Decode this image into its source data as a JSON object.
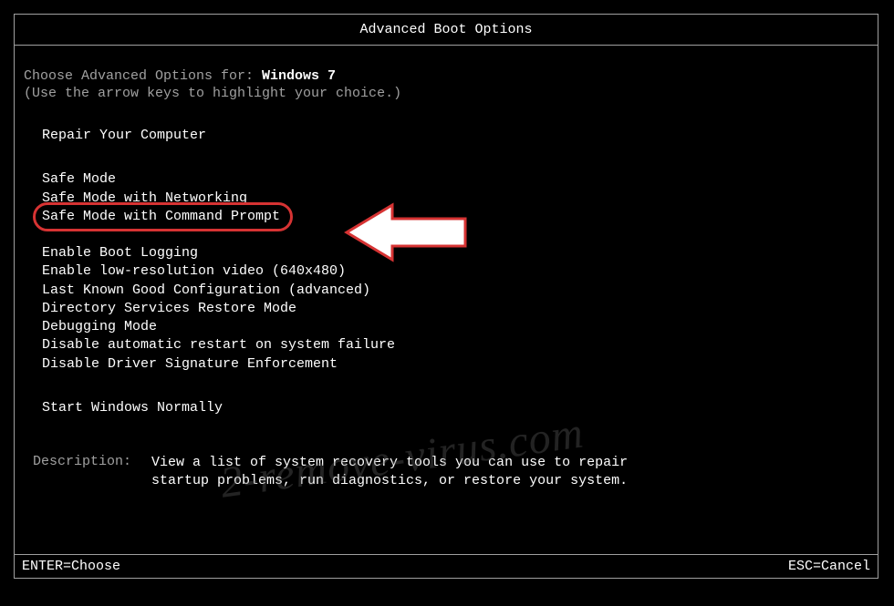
{
  "title": "Advanced Boot Options",
  "choose_prefix": "Choose Advanced Options for: ",
  "os_name": "Windows 7",
  "hint": "(Use the arrow keys to highlight your choice.)",
  "repair_option": "Repair Your Computer",
  "safe_modes": {
    "safe_mode": "Safe Mode",
    "safe_mode_net": "Safe Mode with Networking",
    "safe_mode_cmd": "Safe Mode with Command Prompt"
  },
  "other_options": {
    "boot_logging": "Enable Boot Logging",
    "low_res": "Enable low-resolution video (640x480)",
    "last_known": "Last Known Good Configuration (advanced)",
    "ds_restore": "Directory Services Restore Mode",
    "debugging": "Debugging Mode",
    "disable_restart": "Disable automatic restart on system failure",
    "disable_driver_sig": "Disable Driver Signature Enforcement"
  },
  "start_normal": "Start Windows Normally",
  "description": {
    "label": "Description:",
    "text": "View a list of system recovery tools you can use to repair startup problems, run diagnostics, or restore your system."
  },
  "footer": {
    "enter": "ENTER=Choose",
    "esc": "ESC=Cancel"
  },
  "watermark": "2-remove-virus.com"
}
